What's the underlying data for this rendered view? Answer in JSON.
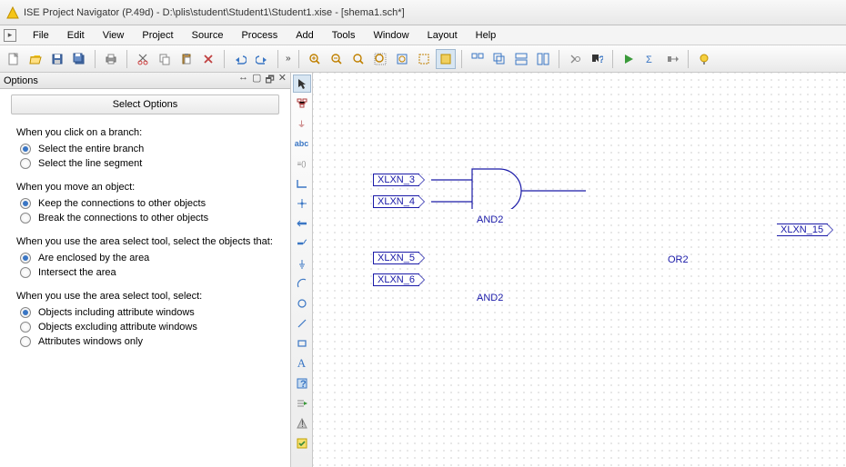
{
  "window": {
    "title": "ISE Project Navigator (P.49d) - D:\\plis\\student\\Student1\\Student1.xise - [shema1.sch*]"
  },
  "menu": {
    "items": [
      "File",
      "Edit",
      "View",
      "Project",
      "Source",
      "Process",
      "Add",
      "Tools",
      "Window",
      "Layout",
      "Help"
    ]
  },
  "options_panel": {
    "title": "Options",
    "tab": "Select Options",
    "group1": {
      "label": "When you click on a branch:",
      "opt1": "Select the entire branch",
      "opt2": "Select the line segment"
    },
    "group2": {
      "label": "When you move an object:",
      "opt1": "Keep the connections to other objects",
      "opt2": "Break the connections to other objects"
    },
    "group3": {
      "label": "When you use the area select tool, select the objects that:",
      "opt1": "Are enclosed by the area",
      "opt2": "Intersect the area"
    },
    "group4": {
      "label": "When you use the area select tool, select:",
      "opt1": "Objects including attribute windows",
      "opt2": "Objects excluding attribute windows",
      "opt3": "Attributes windows only"
    }
  },
  "schematic": {
    "nets": {
      "n3": "XLXN_3",
      "n4": "XLXN_4",
      "n5": "XLXN_5",
      "n6": "XLXN_6",
      "n15": "XLXN_15"
    },
    "gates": {
      "and1": "AND2",
      "and2": "AND2",
      "or1": "OR2"
    }
  },
  "chart_data": {
    "type": "diagram",
    "description": "Logic schematic: two AND2 gates feed an OR2 gate",
    "components": [
      {
        "id": "U1",
        "type": "AND2",
        "inputs": [
          "XLXN_3",
          "XLXN_4"
        ],
        "output_to": "OR2_in_a"
      },
      {
        "id": "U2",
        "type": "AND2",
        "inputs": [
          "XLXN_5",
          "XLXN_6"
        ],
        "output_to": "OR2_in_b"
      },
      {
        "id": "U3",
        "type": "OR2",
        "inputs": [
          "OR2_in_a",
          "OR2_in_b"
        ],
        "output": "XLXN_15"
      }
    ]
  }
}
